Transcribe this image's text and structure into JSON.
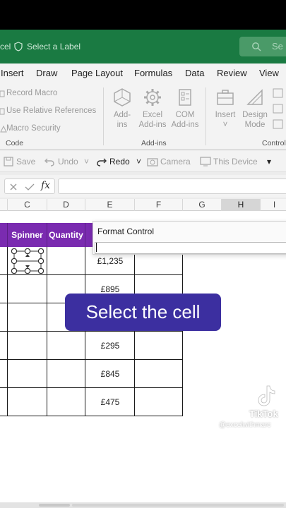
{
  "titlebar": {
    "app_name": "cel",
    "label_text": "Select a Label",
    "search_text": "Se"
  },
  "menu": {
    "items": [
      "Insert",
      "Draw",
      "Page Layout",
      "Formulas",
      "Data",
      "Review",
      "View"
    ]
  },
  "ribbon": {
    "code_items": [
      "Record Macro",
      "Use Relative References",
      "Macro Security"
    ],
    "code_label": "Code",
    "addins_buttons": [
      {
        "line1": "Add-",
        "line2": "ins",
        "icon": "addins-hexagon-icon"
      },
      {
        "line1": "Excel",
        "line2": "Add-ins",
        "icon": "gear-icon"
      },
      {
        "line1": "COM",
        "line2": "Add-ins",
        "icon": "com-addins-icon"
      }
    ],
    "addins_label": "Add-ins",
    "controls_buttons": [
      {
        "line1": "Insert",
        "line2": "˅",
        "icon": "toolbox-icon"
      },
      {
        "line1": "Design",
        "line2": "Mode",
        "icon": "design-mode-icon"
      }
    ],
    "controls_label": "Control"
  },
  "qat": {
    "save": "Save",
    "undo": "Undo",
    "redo": "Redo",
    "camera": "Camera",
    "this_device": "This Device"
  },
  "formula_bar": {
    "fx": "fx",
    "value": ""
  },
  "columns": [
    "C",
    "D",
    "E",
    "F",
    "G",
    "H",
    "I"
  ],
  "selected_column": "H",
  "table": {
    "headers": [
      "Spinner",
      "Quantity"
    ],
    "prices": [
      "£1,235",
      "£895",
      "£295",
      "£845",
      "£475"
    ]
  },
  "format_control": {
    "title": "Format Control",
    "value": ""
  },
  "caption": "Select the cell",
  "watermark": {
    "brand": "TikTok",
    "handle": "@excelwithmarc"
  },
  "colors": {
    "title_green": "#1a7a42",
    "header_purple": "#7a2bb0",
    "caption_bg": "#3c2fa0"
  }
}
